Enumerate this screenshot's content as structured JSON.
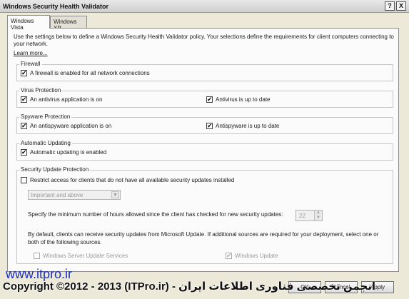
{
  "window": {
    "title": "Windows Security Health Validator",
    "help_glyph": "?",
    "close_glyph": "X"
  },
  "tabs": [
    {
      "label": "Windows Vista"
    },
    {
      "label": "Windows XP"
    }
  ],
  "intro": "Use the settings below to define a Windows Security Health Validator policy. Your selections define the requirements for client computers connecting to your network.",
  "learn_more": "Learn more...",
  "firewall": {
    "legend": "Firewall",
    "enabled_label": "A firewall is enabled for all network connections",
    "enabled_checked": true
  },
  "virus": {
    "legend": "Virus Protection",
    "app_label": "An antivirus application is on",
    "app_checked": true,
    "update_label": "Antivirus is up to date",
    "update_checked": true
  },
  "spyware": {
    "legend": "Spyware Protection",
    "app_label": "An antispyware application is on",
    "app_checked": true,
    "update_label": "Antispyware is up to date",
    "update_checked": true
  },
  "auto_update": {
    "legend": "Automatic Updating",
    "label": "Automatic updating is enabled",
    "checked": true
  },
  "security_updates": {
    "legend": "Security Update Protection",
    "restrict_label": "Restrict access for clients that do not have all available security updates installed",
    "restrict_checked": false,
    "severity_value": "Important and above",
    "hours_text": "Specify the minimum number of hours allowed since the client has checked for new security updates:",
    "hours_value": "22",
    "sources_text": "By default, clients can receive security updates from Microsoft Update.  If additional sources are required for your deployment, select one or both of the following sources.",
    "wsus_label": "Windows Server Update Services",
    "wsus_checked": false,
    "wu_label": "Windows Update",
    "wu_checked": true
  },
  "watermark": {
    "site": "www.itpro.ir",
    "copyright": "Copyright ©2012 - 2013 (ITPro.ir) - انجمن تخصصی فناوری اطلاعات ایران"
  },
  "buttons": {
    "ok": "OK",
    "cancel": "Cancel",
    "apply": "Apply"
  },
  "check_glyph": "✔"
}
